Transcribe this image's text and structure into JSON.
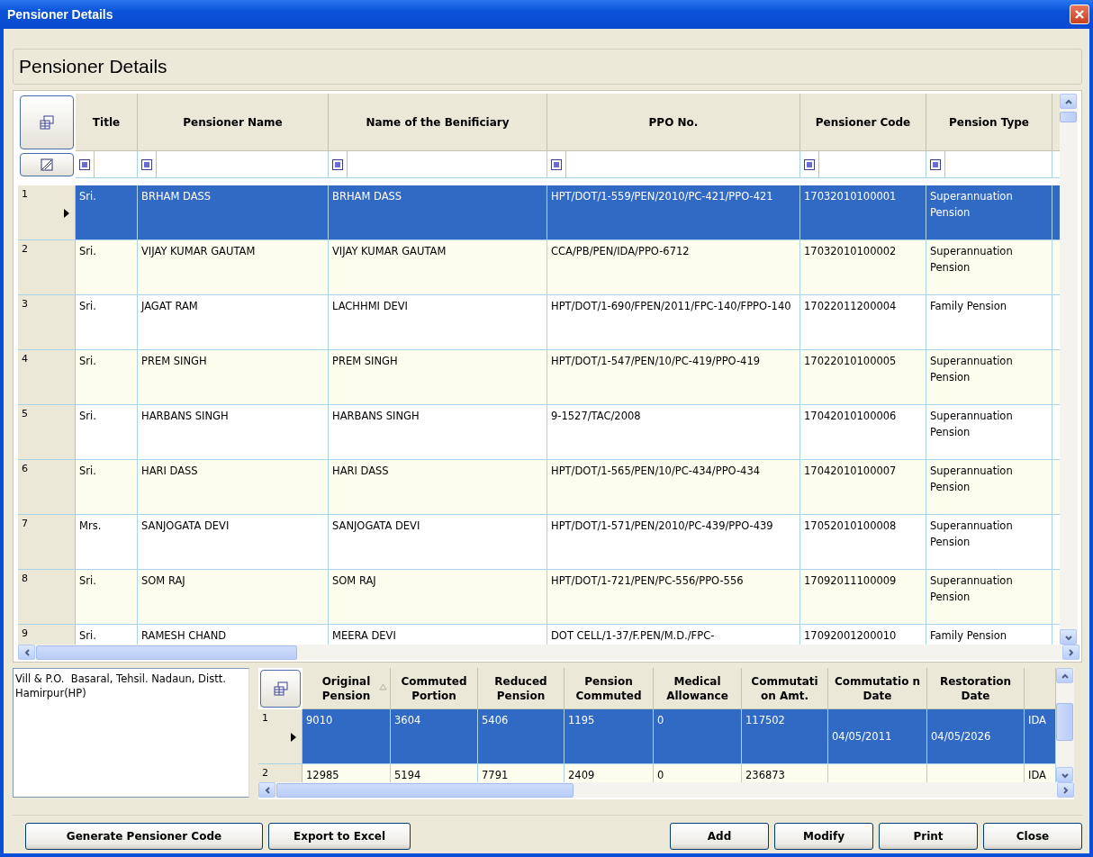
{
  "window": {
    "title": "Pensioner Details"
  },
  "heading": "Pensioner Details",
  "grid": {
    "columns": [
      {
        "label": "Title"
      },
      {
        "label": "Pensioner Name"
      },
      {
        "label": "Name of the Benificiary"
      },
      {
        "label": "PPO No."
      },
      {
        "label": "Pensioner Code"
      },
      {
        "label": "Pension Type"
      }
    ],
    "rows": [
      {
        "number": "1",
        "selected": true,
        "cells": [
          "Sri.",
          "BRHAM DASS",
          "BRHAM DASS",
          "HPT/DOT/1-559/PEN/2010/PC-421/PPO-421",
          "17032010100001",
          "Superannuation Pension"
        ]
      },
      {
        "number": "2",
        "selected": false,
        "cells": [
          "Sri.",
          "VIJAY KUMAR GAUTAM",
          "VIJAY KUMAR GAUTAM",
          "CCA/PB/PEN/IDA/PPO-6712",
          "17032010100002",
          "Superannuation Pension"
        ]
      },
      {
        "number": "3",
        "selected": false,
        "cells": [
          "Sri.",
          "JAGAT RAM",
          "LACHHMI DEVI",
          "HPT/DOT/1-690/FPEN/2011/FPC-140/FPPO-140",
          "17022011200004",
          "Family Pension"
        ]
      },
      {
        "number": "4",
        "selected": false,
        "cells": [
          "Sri.",
          "PREM SINGH",
          "PREM SINGH",
          "HPT/DOT/1-547/PEN/10/PC-419/PPO-419",
          "17022010100005",
          "Superannuation Pension"
        ]
      },
      {
        "number": "5",
        "selected": false,
        "cells": [
          "Sri.",
          "HARBANS SINGH",
          "HARBANS SINGH",
          "9-1527/TAC/2008",
          "17042010100006",
          "Superannuation Pension"
        ]
      },
      {
        "number": "6",
        "selected": false,
        "cells": [
          "Sri.",
          "HARI DASS",
          "HARI DASS",
          "HPT/DOT/1-565/PEN/10/PC-434/PPO-434",
          "17042010100007",
          "Superannuation Pension"
        ]
      },
      {
        "number": "7",
        "selected": false,
        "cells": [
          "Mrs.",
          "SANJOGATA DEVI",
          "SANJOGATA DEVI",
          "HPT/DOT/1-571/PEN/2010/PC-439/PPO-439",
          "17052010100008",
          "Superannuation Pension"
        ]
      },
      {
        "number": "8",
        "selected": false,
        "cells": [
          "Sri.",
          "SOM RAJ",
          "SOM RAJ",
          "HPT/DOT/1-721/PEN/PC-556/PPO-556",
          "17092011100009",
          "Superannuation Pension"
        ]
      },
      {
        "number": "9",
        "selected": false,
        "cells": [
          "Sri.",
          "RAMESH CHAND",
          "MEERA DEVI",
          "DOT CELL/1-37/F.PEN/M.D./FPC-",
          "17092001200010",
          "Family Pension"
        ]
      }
    ]
  },
  "address": "Vill & P.O.  Basaral, Tehsil. Nadaun, Distt. Hamirpur(HP)",
  "detail_grid": {
    "columns": [
      {
        "label": "Original Pension",
        "kind": "text",
        "sorted": true
      },
      {
        "label": "Commuted Portion",
        "kind": "text",
        "sorted": false
      },
      {
        "label": "Reduced Pension",
        "kind": "text",
        "sorted": false
      },
      {
        "label": "Pension Commuted",
        "kind": "text",
        "sorted": false
      },
      {
        "label": "Medical Allowance",
        "kind": "text",
        "sorted": false
      },
      {
        "label": "Commutati on Amt.",
        "kind": "text",
        "sorted": false
      },
      {
        "label": "Commutatio n Date",
        "kind": "date",
        "sorted": false
      },
      {
        "label": "Restoration Date",
        "kind": "date",
        "sorted": false
      },
      {
        "kind": "text",
        "sorted": false
      }
    ],
    "rows": [
      {
        "number": "1",
        "selected": true,
        "cells": [
          "9010",
          "3604",
          "5406",
          "1195",
          "0",
          "117502",
          "04/05/2011",
          "04/05/2026",
          "IDA"
        ]
      },
      {
        "number": "2",
        "selected": false,
        "cells": [
          "12985",
          "5194",
          "7791",
          "2409",
          "0",
          "236873",
          "",
          "",
          "IDA"
        ]
      }
    ]
  },
  "buttons_left": [
    "Generate Pensioner Code",
    "Export to Excel"
  ],
  "buttons_right": [
    "Add",
    "Modify",
    "Print",
    "Close"
  ]
}
